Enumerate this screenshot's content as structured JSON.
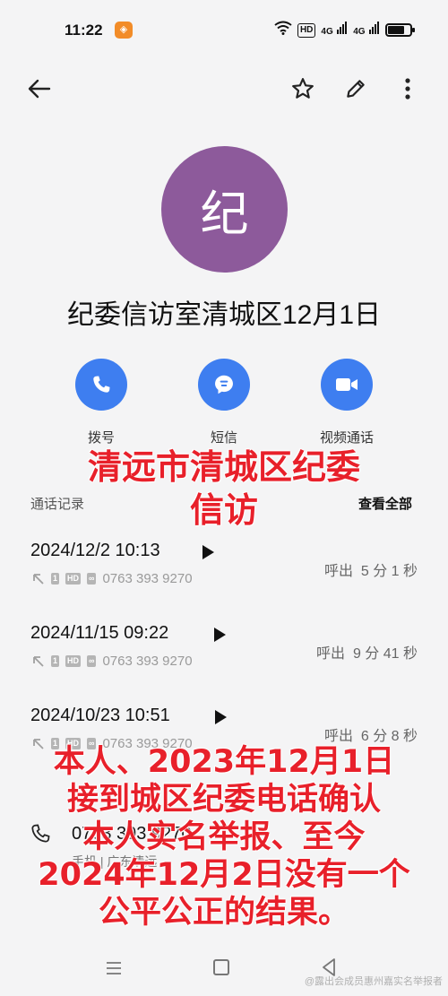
{
  "status_bar": {
    "time": "11:22",
    "network_chip_1": "HD",
    "signal_1": "4G",
    "signal_2": "4G"
  },
  "toolbar": {
    "back_icon": "arrow-left-icon",
    "star_icon": "star-icon",
    "edit_icon": "pencil-icon",
    "more_icon": "more-vertical-icon"
  },
  "contact": {
    "avatar_initial": "纪",
    "avatar_color": "#8d5a9b",
    "name": "纪委信访室清城区12月1日"
  },
  "actions": [
    {
      "label": "拨号",
      "icon": "phone-icon"
    },
    {
      "label": "短信",
      "icon": "message-icon"
    },
    {
      "label": "视频通话",
      "icon": "video-icon"
    }
  ],
  "accent_color": "#3e7ef0",
  "call_log": {
    "title": "通话记录",
    "view_all": "查看全部",
    "items": [
      {
        "datetime": "2024/12/2 10:13",
        "number": "0763 393 9270",
        "sim": "1",
        "hd": "HD",
        "direction": "呼出",
        "duration": "5 分 1 秒"
      },
      {
        "datetime": "2024/11/15 09:22",
        "number": "0763 393 9270",
        "sim": "1",
        "hd": "HD",
        "direction": "呼出",
        "duration": "9 分 41 秒"
      },
      {
        "datetime": "2024/10/23 10:51",
        "number": "0763 393 9270",
        "sim": "1",
        "hd": "HD",
        "direction": "呼出",
        "duration": "6 分 8 秒"
      }
    ]
  },
  "phone": {
    "number": "0763 393 9270",
    "type": "手机 | 广东清远"
  },
  "overlay": {
    "top_line_1": "清远市清城区纪委",
    "top_line_2": "信访",
    "bottom_line_1": "本人、2023年12月1日",
    "bottom_line_2": "接到城区纪委电话确认",
    "bottom_line_3": "本人实名举报、至今",
    "bottom_line_4": "2024年12月2日没有一个",
    "bottom_line_5": "公平公正的结果。",
    "color": "#e8202a"
  },
  "watermark": "@露出会成员惠州嘉实名举报者"
}
